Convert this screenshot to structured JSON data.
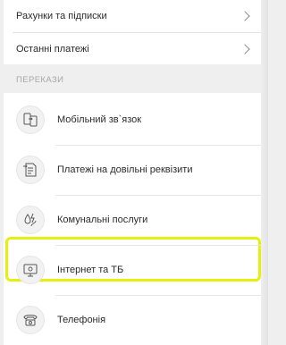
{
  "menu": {
    "items": [
      {
        "label": "Рахунки та підписки"
      },
      {
        "label": "Останні платежі"
      }
    ]
  },
  "transfers": {
    "section_title": "ПЕРЕКАЗИ",
    "items": [
      {
        "label": "Мобільний зв`язок",
        "icon": "phone-transfer-icon"
      },
      {
        "label": "Платежі на довільні реквізити",
        "icon": "document-arrow-icon"
      },
      {
        "label": "Комунальні послуги",
        "icon": "utilities-icon"
      },
      {
        "label": "Інтернет та ТБ",
        "icon": "tv-icon"
      },
      {
        "label": "Телефонія",
        "icon": "telephone-icon"
      }
    ]
  },
  "colors": {
    "highlight": "#e6ef0d",
    "background": "#efefef",
    "card": "#ffffff"
  }
}
